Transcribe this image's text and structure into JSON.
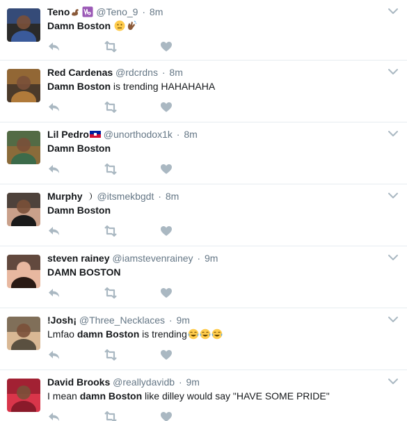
{
  "tweets": [
    {
      "name": "Teno",
      "name_emoji": [
        "flexed-biceps-medium-dark",
        "capricorn-sign"
      ],
      "handle": "@Teno_9",
      "time": "8m",
      "segments": [
        {
          "text": "Damn Boston",
          "bold": true
        },
        {
          "text": " ",
          "bold": false
        }
      ],
      "text_emoji": [
        "neutral-face",
        "waving-hand-medium-dark"
      ],
      "avatar_colors": [
        "#3a5a9a",
        "#2a2a2a"
      ]
    },
    {
      "name": "Red Cardenas",
      "name_emoji": [],
      "handle": "@rdcrdns",
      "time": "8m",
      "segments": [
        {
          "text": "Damn Boston",
          "bold": true
        },
        {
          "text": " is trending HAHAHAHA",
          "bold": false
        }
      ],
      "text_emoji": [],
      "avatar_colors": [
        "#b07a3a",
        "#4b3a2a"
      ]
    },
    {
      "name": "Lil Pedro",
      "name_emoji": [
        "flag-haiti"
      ],
      "handle": "@unorthodox1k",
      "time": "8m",
      "segments": [
        {
          "text": "Damn Boston",
          "bold": true
        }
      ],
      "text_emoji": [],
      "avatar_colors": [
        "#3c6b4a",
        "#8a6b3a"
      ]
    },
    {
      "name": "Murphy",
      "name_emoji": [
        "moon-symbol"
      ],
      "handle": "@itsmekbgdt",
      "time": "8m",
      "segments": [
        {
          "text": "Damn Boston",
          "bold": true
        }
      ],
      "text_emoji": [],
      "avatar_colors": [
        "#1a1a1a",
        "#c9a08a"
      ]
    },
    {
      "name": "steven rainey",
      "name_emoji": [],
      "handle": "@iamstevenrainey",
      "time": "9m",
      "segments": [
        {
          "text": "DAMN BOSTON",
          "bold": true
        }
      ],
      "text_emoji": [],
      "avatar_colors": [
        "#2a1a14",
        "#e8b8a0"
      ]
    },
    {
      "name": "!Josh¡",
      "name_emoji": [],
      "handle": "@Three_Necklaces",
      "time": "9m",
      "segments": [
        {
          "text": "Lmfao ",
          "bold": false
        },
        {
          "text": "damn Boston",
          "bold": true
        },
        {
          "text": " is trending",
          "bold": false
        }
      ],
      "text_emoji": [
        "tears-of-joy",
        "tears-of-joy",
        "tears-of-joy"
      ],
      "avatar_colors": [
        "#5a5040",
        "#d9b894"
      ]
    },
    {
      "name": "David Brooks",
      "name_emoji": [],
      "handle": "@reallydavidb",
      "time": "9m",
      "segments": [
        {
          "text": "I mean ",
          "bold": false
        },
        {
          "text": "damn Boston",
          "bold": true
        },
        {
          "text": " like dilley would say \"HAVE SOME PRIDE\"",
          "bold": false
        }
      ],
      "text_emoji": [],
      "avatar_colors": [
        "#8a1a2a",
        "#d9354a"
      ]
    }
  ],
  "separator": "·",
  "colors": {
    "text": "#14171a",
    "muted": "#657786",
    "icon": "#aab8c2",
    "border": "#e6ecf0"
  }
}
